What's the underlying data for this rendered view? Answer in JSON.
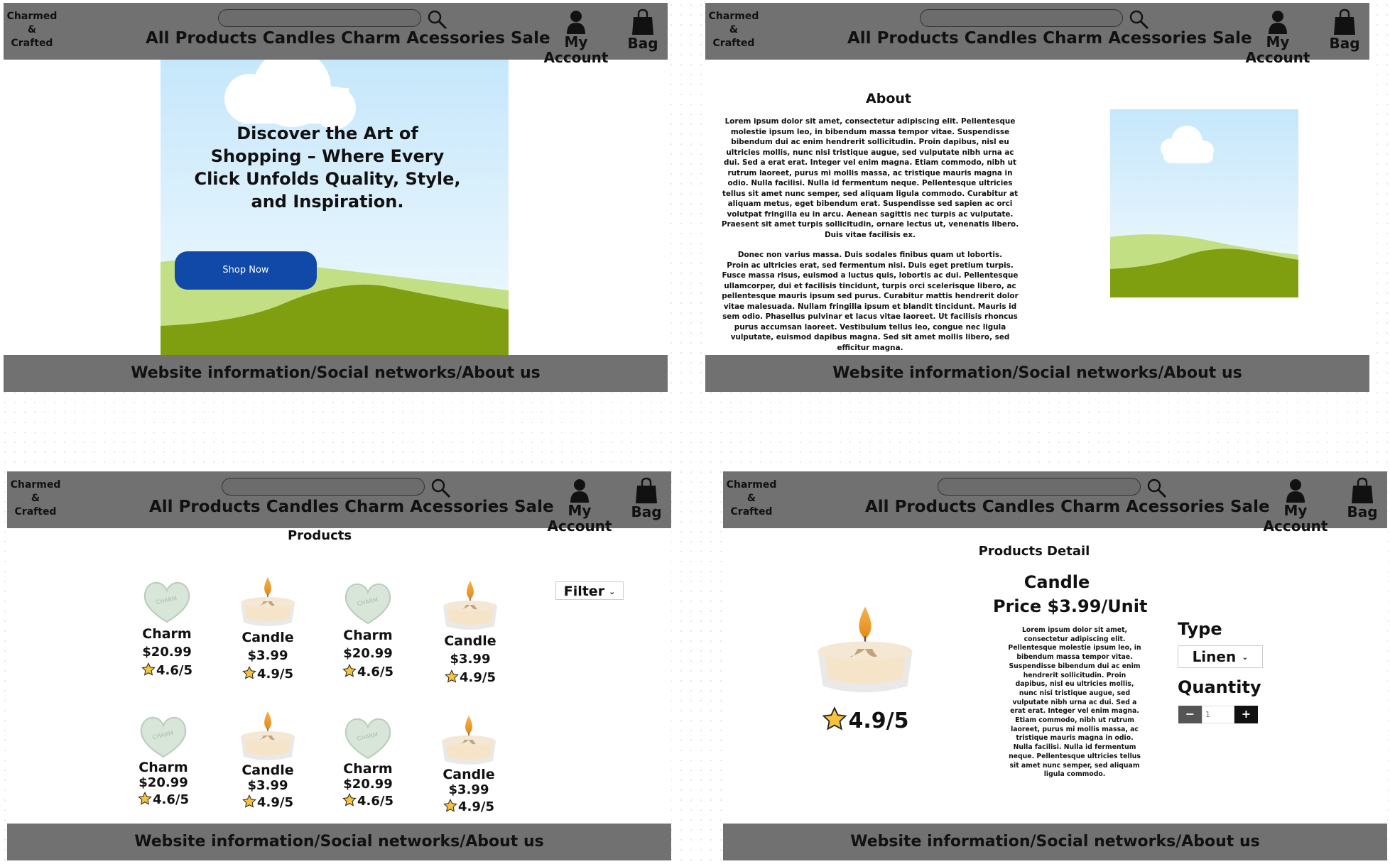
{
  "header": {
    "logo_line1": "Charmed",
    "logo_line2": "&",
    "logo_line3": "Crafted",
    "nav_text": "All Products Candles Charm Acessories Sale",
    "account_label": "My Account",
    "bag_label": "Bag"
  },
  "footer": {
    "text": "Website information/Social networks/About us"
  },
  "home": {
    "hero_text": "Discover the Art of Shopping – Where Every Click Unfolds Quality, Style, and Inspiration.",
    "shop_button": "Shop Now"
  },
  "about": {
    "title": "About",
    "paragraph1": "Lorem ipsum dolor sit amet, consectetur adipiscing elit. Pellentesque molestie ipsum leo, in bibendum massa tempor vitae. Suspendisse bibendum dui ac enim hendrerit sollicitudin. Proin dapibus, nisl eu ultricies mollis, nunc nisi tristique augue, sed vulputate nibh urna ac dui. Sed a erat erat. Integer vel enim magna. Etiam commodo, nibh ut rutrum laoreet, purus mi mollis massa, ac tristique mauris magna in odio. Nulla facilisi. Nulla id fermentum neque. Pellentesque ultricies tellus sit amet nunc semper, sed aliquam ligula commodo. Curabitur at aliquam metus, eget bibendum erat. Suspendisse sed sapien ac orci volutpat fringilla eu in arcu. Aenean sagittis nec turpis ac vulputate. Praesent sit amet turpis sollicitudin, ornare lectus ut, venenatis libero. Duis vitae facilisis ex.",
    "paragraph2a": "Donec non varius massa. Duis sodales finibus quam ut lobortis.",
    "paragraph2b": "Proin ac ultricies erat, sed fermentum nisi. Duis eget pretium turpis. Fusce massa risus, euismod a luctus quis, lobortis ac dui. Pellentesque ullamcorper, dui et facilisis tincidunt, turpis orci scelerisque libero, ac pellentesque mauris ipsum sed purus. Curabitur mattis hendrerit dolor vitae malesuada. Nullam fringilla ipsum et blandit tincidunt. Mauris id sem odio. Phasellus pulvinar et lacus vitae laoreet. Ut facilisis rhoncus purus accumsan laoreet. Vestibulum tellus leo, congue nec ligula vulputate, euismod dapibus magna. Sed sit amet mollis libero, sed efficitur magna."
  },
  "products": {
    "title": "Products",
    "filter_label": "Filter",
    "items": [
      {
        "name": "Charm",
        "price": "$20.99",
        "rating": "4.6/5",
        "icon": "charm-heart-icon"
      },
      {
        "name": "Candle",
        "price": "$3.99",
        "rating": "4.9/5",
        "icon": "candle-icon"
      },
      {
        "name": "Charm",
        "price": "$20.99",
        "rating": "4.6/5",
        "icon": "charm-heart-icon"
      },
      {
        "name": "Candle",
        "price": "$3.99",
        "rating": "4.9/5",
        "icon": "candle-icon"
      },
      {
        "name": "Charm",
        "price": "$20.99",
        "rating": "4.6/5",
        "icon": "charm-heart-icon"
      },
      {
        "name": "Candle",
        "price": "$3.99",
        "rating": "4.9/5",
        "icon": "candle-icon"
      },
      {
        "name": "Charm",
        "price": "$20.99",
        "rating": "4.6/5",
        "icon": "charm-heart-icon"
      },
      {
        "name": "Candle",
        "price": "$3.99",
        "rating": "4.9/5",
        "icon": "candle-icon"
      }
    ]
  },
  "detail": {
    "title": "Products Detail",
    "name": "Candle",
    "price": "Price $3.99/Unit",
    "rating": "4.9/5",
    "description": "Lorem ipsum dolor sit amet, consectetur adipiscing elit. Pellentesque molestie ipsum leo, in bibendum massa tempor vitae. Suspendisse bibendum dui ac enim hendrerit sollicitudin. Proin dapibus, nisl eu ultricies mollis, nunc nisi tristique augue, sed vulputate nibh urna ac dui. Sed a erat erat. Integer vel enim magna. Etiam commodo, nibh ut rutrum laoreet, purus mi mollis massa, ac tristique mauris magna in odio. Nulla facilisi. Nulla id fermentum neque. Pellentesque ultricies tellus sit amet nunc semper, sed aliquam ligula commodo.",
    "type_label": "Type",
    "type_value": "Linen",
    "quantity_label": "Quantity",
    "quantity_value": "1",
    "minus_label": "−",
    "plus_label": "+"
  },
  "colors": {
    "header_bg": "#717171",
    "footer_bg": "#717171",
    "button_blue": "#1049a8",
    "grass_light": "#c3df84",
    "grass_dark": "#7f9f10",
    "sky_top": "#cbe9fb",
    "star": "#f6c33b"
  }
}
